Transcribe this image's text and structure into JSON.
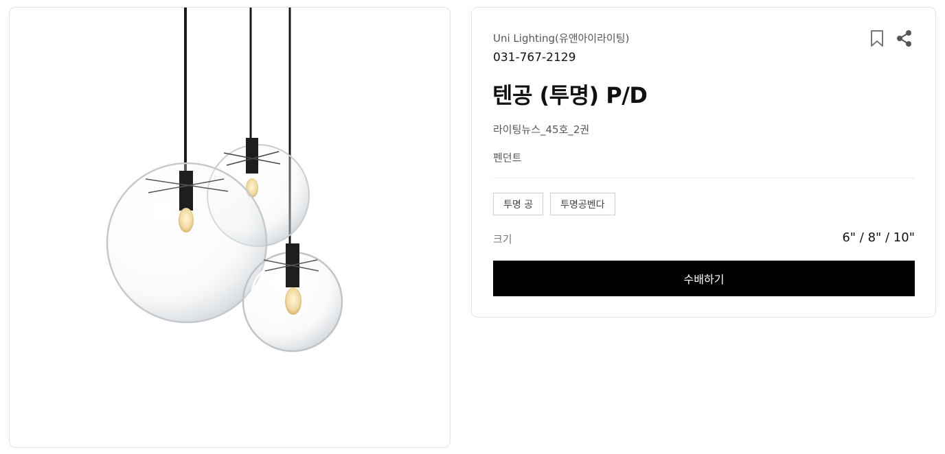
{
  "product": {
    "brand": "Uni Lighting(유앤아이라이팅)",
    "phone": "031-767-2129",
    "title": "텐공 (투명) P/D",
    "catalog": "라이팅뉴스_45호_2권",
    "category": "펜던트",
    "tags": [
      "투명 공",
      "투명공벤다"
    ],
    "size_label": "크기",
    "size_value": "6\" / 8\" / 10\"",
    "order_label": "수배하기"
  },
  "icons": {
    "bookmark": "bookmark-icon",
    "share": "share-icon"
  },
  "colors": {
    "button_bg": "#000000",
    "button_text": "#ffffff",
    "border": "#e3e3e3"
  }
}
